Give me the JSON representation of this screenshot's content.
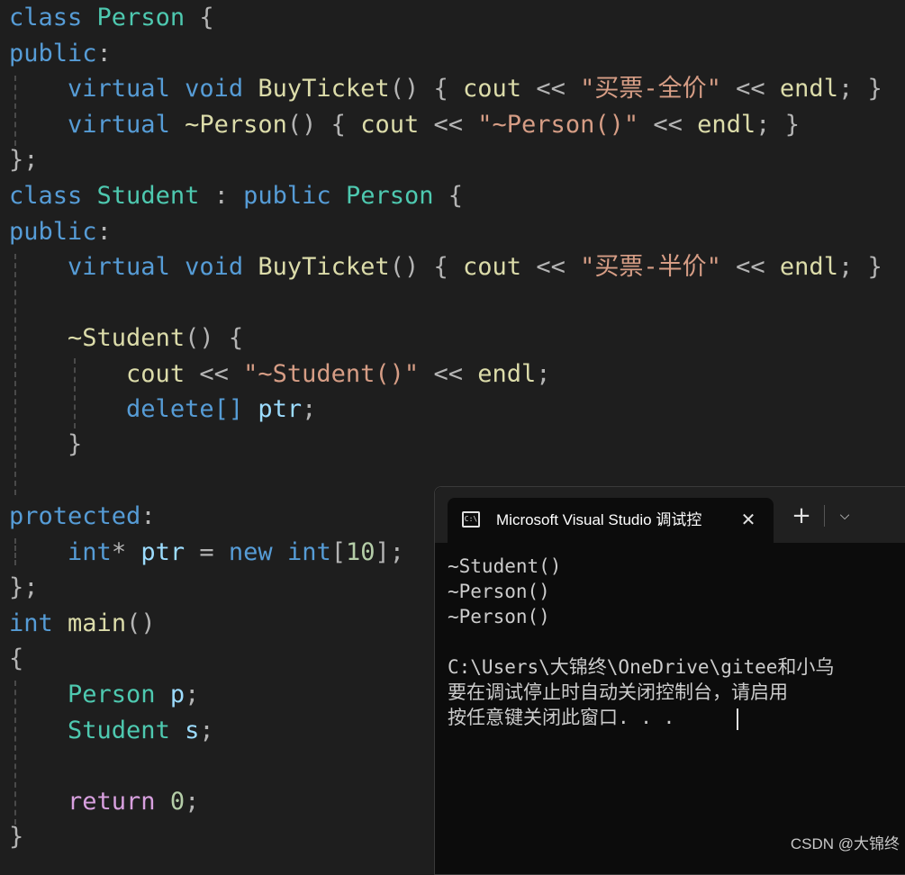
{
  "code": {
    "l1": {
      "kw": "class",
      "name": "Person",
      "brace": "{"
    },
    "l2": {
      "spec": "public",
      "colon": ":"
    },
    "l3": {
      "virt": "virtual",
      "ret": "void",
      "fn": "BuyTicket",
      "paren": "()",
      "ob": "{",
      "cout": "cout",
      "op": "<<",
      "str": "\"买票-全价\"",
      "op2": "<<",
      "endl": "endl",
      "tail": ";",
      "cb": "}"
    },
    "l4": {
      "virt": "virtual",
      "dtor": "~Person",
      "paren": "()",
      "ob": "{",
      "cout": "cout",
      "op": "<<",
      "str": "\"~Person()\"",
      "op2": "<<",
      "endl": "endl",
      "tail": ";",
      "cb": "}"
    },
    "l5": {
      "text": "};"
    },
    "l6": {
      "kw": "class",
      "name": "Student",
      "colon": ":",
      "pub": "public",
      "base": "Person",
      "brace": "{"
    },
    "l7": {
      "spec": "public",
      "colon": ":"
    },
    "l8": {
      "virt": "virtual",
      "ret": "void",
      "fn": "BuyTicket",
      "paren": "()",
      "ob": "{",
      "cout": "cout",
      "op": "<<",
      "str": "\"买票-半价\"",
      "op2": "<<",
      "endl": "endl",
      "tail": ";",
      "cb": "}"
    },
    "l10": {
      "dtor": "~Student",
      "paren": "()",
      "ob": "{"
    },
    "l11": {
      "cout": "cout",
      "op": "<<",
      "str": "\"~Student()\"",
      "op2": "<<",
      "endl": "endl",
      "tail": ";"
    },
    "l12": {
      "del": "delete[]",
      "var": "ptr",
      "tail": ";"
    },
    "l13": {
      "text": "}"
    },
    "l15": {
      "spec": "protected",
      "colon": ":"
    },
    "l16": {
      "type": "int",
      "star": "*",
      "var": "ptr",
      "eq": "=",
      "nw": "new",
      "type2": "int",
      "arr": "[",
      "num": "10",
      "arr2": "];"
    },
    "l17": {
      "text": "};"
    },
    "l18": {
      "type": "int",
      "fn": "main",
      "paren": "()"
    },
    "l19": {
      "text": "{"
    },
    "l20": {
      "type": "Person",
      "var": "p",
      "tail": ";"
    },
    "l21": {
      "type": "Student",
      "var": "s",
      "tail": ";"
    },
    "l23": {
      "ret": "return",
      "num": "0",
      "tail": ";"
    },
    "l24": {
      "text": "}"
    }
  },
  "terminal": {
    "tab_title": "Microsoft Visual Studio 调试控",
    "icon_text": "C:\\",
    "close_glyph": "✕",
    "plus_glyph": "+",
    "chevron_glyph": "⌵",
    "output": [
      "~Student()",
      "~Person()",
      "~Person()",
      "",
      "C:\\Users\\大锦终\\OneDrive\\gitee和小乌",
      "要在调试停止时自动关闭控制台，请启用",
      "按任意键关闭此窗口. . ."
    ]
  },
  "watermark": "CSDN @大锦终"
}
